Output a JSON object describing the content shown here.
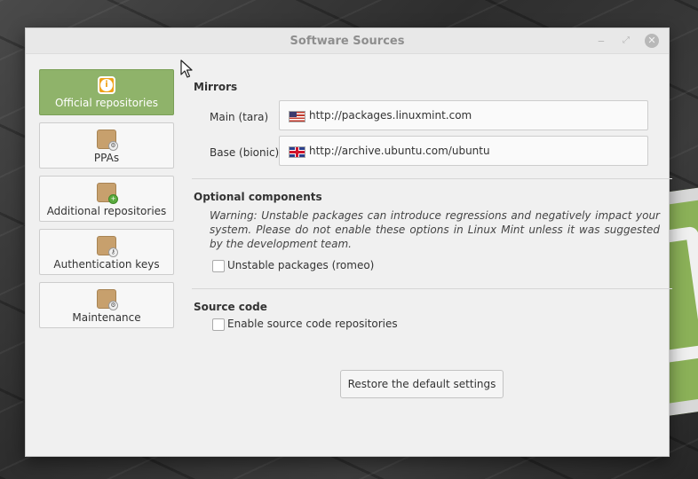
{
  "window": {
    "title": "Software Sources",
    "controls": {
      "minimize": "‒",
      "maximize": "⤢",
      "close": "✕"
    }
  },
  "sidebar": {
    "items": [
      {
        "label": "Official repositories",
        "icon": "info-icon",
        "active": true
      },
      {
        "label": "PPAs",
        "icon": "package-gear-icon",
        "active": false
      },
      {
        "label": "Additional repositories",
        "icon": "package-add-icon",
        "active": false
      },
      {
        "label": "Authentication keys",
        "icon": "package-key-icon",
        "active": false
      },
      {
        "label": "Maintenance",
        "icon": "package-gear-icon",
        "active": false
      }
    ]
  },
  "mirrors": {
    "title": "Mirrors",
    "main": {
      "label": "Main (tara)",
      "url": "http://packages.linuxmint.com",
      "flag": "us-flag-icon"
    },
    "base": {
      "label": "Base (bionic)",
      "url": "http://archive.ubuntu.com/ubuntu",
      "flag": "uk-flag-icon"
    }
  },
  "optional": {
    "title": "Optional components",
    "warning": "Warning: Unstable packages can introduce regressions and negatively impact your system. Please do not enable these options in Linux Mint unless it was suggested by the development team.",
    "unstable_label": "Unstable packages (romeo)",
    "unstable_checked": false
  },
  "source_code": {
    "title": "Source code",
    "enable_label": "Enable source code repositories",
    "enable_checked": false
  },
  "restore_button": "Restore the default settings",
  "colors": {
    "active_tab": "#8fb36a",
    "info_orange": "#f0a218",
    "window_bg": "#f0f0f0"
  }
}
